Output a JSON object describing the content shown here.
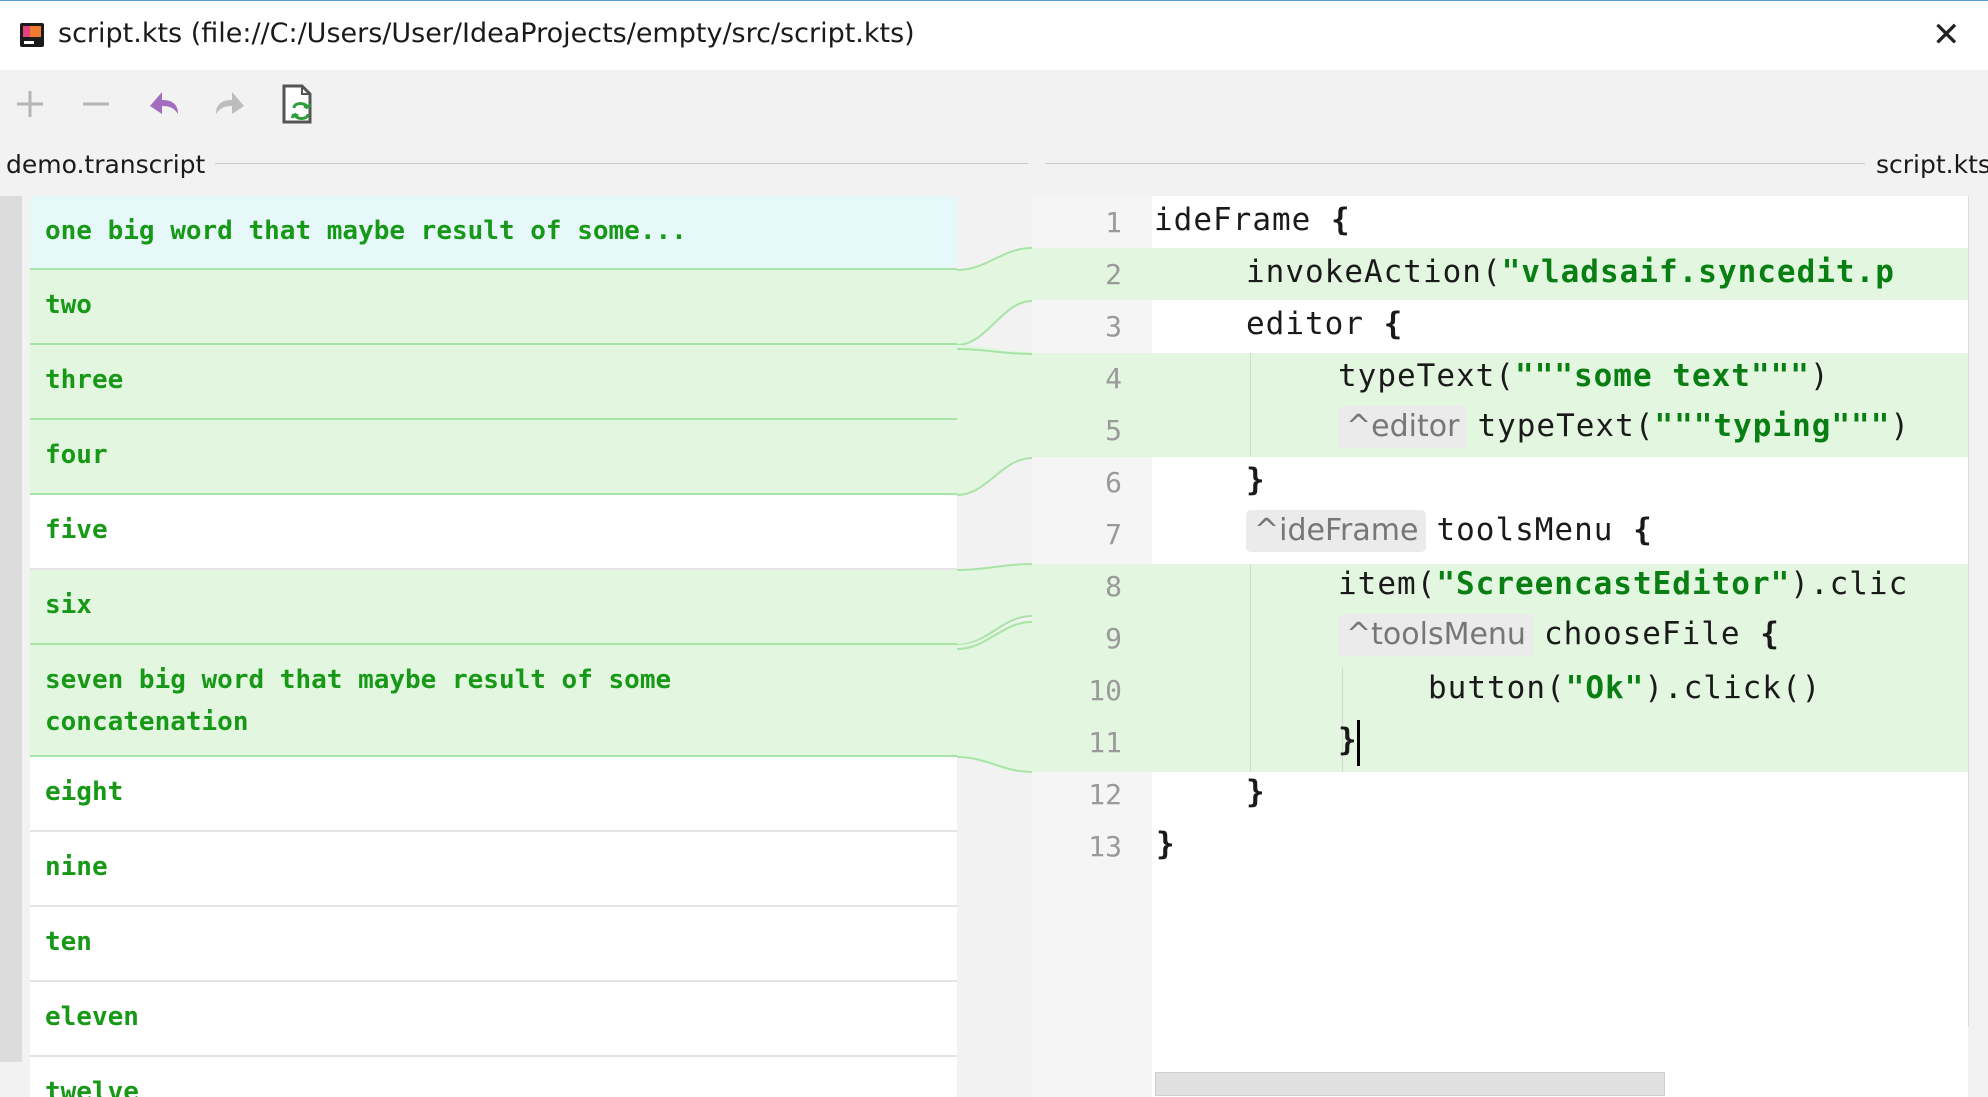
{
  "window": {
    "title": "script.kts (file://C:/Users/User/IdeaProjects/empty/src/script.kts)",
    "close_glyph": "✕"
  },
  "toolbar": {
    "buttons": [
      {
        "name": "add-icon",
        "enabled": false
      },
      {
        "name": "remove-icon",
        "enabled": false
      },
      {
        "name": "undo-icon",
        "enabled": true,
        "color": "#9b59b6"
      },
      {
        "name": "redo-icon",
        "enabled": false
      },
      {
        "name": "sync-file-icon",
        "enabled": true,
        "color": "#2e9e3a"
      }
    ]
  },
  "left_panel": {
    "header": "demo.transcript",
    "items": [
      {
        "text": "one big word that maybe result of some...",
        "state": "selected"
      },
      {
        "text": "two",
        "state": "linked"
      },
      {
        "text": "three",
        "state": "linked"
      },
      {
        "text": "four",
        "state": "linked"
      },
      {
        "text": "five",
        "state": "plain"
      },
      {
        "text": "six",
        "state": "linked"
      },
      {
        "text": "seven big word that maybe result of some",
        "text2": "concatenation",
        "state": "linked"
      },
      {
        "text": "eight",
        "state": "plain"
      },
      {
        "text": "nine",
        "state": "plain"
      },
      {
        "text": "ten",
        "state": "plain"
      },
      {
        "text": "eleven",
        "state": "plain"
      },
      {
        "text": "twelve",
        "state": "plain"
      }
    ]
  },
  "right_panel": {
    "header": "script.kts",
    "line_numbers": [
      "1",
      "2",
      "3",
      "4",
      "5",
      "6",
      "7",
      "8",
      "9",
      "10",
      "11",
      "12",
      "13"
    ],
    "code": {
      "l1": "ideFrame ",
      "l2a": "invokeAction(",
      "l2s": "\"vladsaif.syncedit.p",
      "l3": "editor ",
      "l4a": "typeText(",
      "l4s": "\"\"\"some text\"\"\"",
      "l4b": ")",
      "l5h": "^editor",
      "l5a": "typeText(",
      "l5s": "\"\"\"typing\"\"\"",
      "l5b": ")",
      "l7h": "^ideFrame",
      "l7a": "toolsMenu ",
      "l8a": "item(",
      "l8s": "\"ScreencastEditor\"",
      "l8b": ").clic",
      "l9h": "^toolsMenu",
      "l9a": "chooseFile ",
      "l10a": "button(",
      "l10s": "\"Ok\"",
      "l10b": ").click()",
      "open_brace": "{",
      "close_brace": "}"
    }
  },
  "colors": {
    "string": "#097f13",
    "transcript_text": "#179917",
    "linked_bg": "#e3f7e0",
    "selected_bg": "#e7f8fb",
    "connector": "#a8e4a8"
  }
}
